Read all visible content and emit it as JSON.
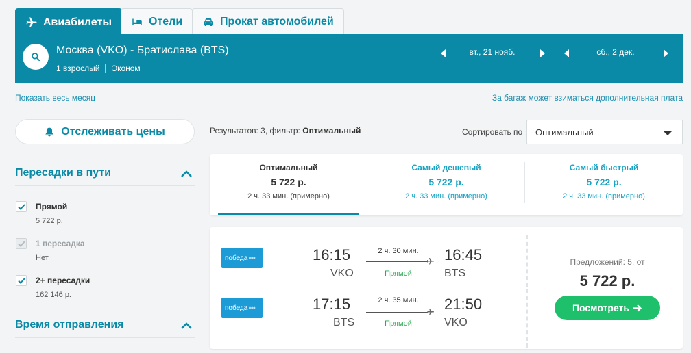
{
  "tabs": [
    {
      "label": "Авиабилеты",
      "icon": "plane-icon"
    },
    {
      "label": "Отели",
      "icon": "bed-icon"
    },
    {
      "label": "Прокат автомобилей",
      "icon": "car-icon"
    }
  ],
  "search": {
    "route": "Москва (VKO) - Братислава (BTS)",
    "passengers": "1 взрослый",
    "class": "Эконом",
    "depart_date": "вт., 21 нояб.",
    "return_date": "сб., 2 дек."
  },
  "links": {
    "show_month": "Показать весь месяц",
    "baggage_note": "За багаж может взиматься дополнительная плата"
  },
  "sidebar": {
    "track_prices": "Отслеживать цены",
    "stops_title": "Пересадки в пути",
    "stops": [
      {
        "label": "Прямой",
        "sub": "5 722 р.",
        "checked": true,
        "disabled": false
      },
      {
        "label": "1 пересадка",
        "sub": "Нет",
        "checked": true,
        "disabled": true
      },
      {
        "label": "2+ пересадки",
        "sub": "162 146 р.",
        "checked": true,
        "disabled": false
      }
    ],
    "departure_title": "Время отправления"
  },
  "results": {
    "count_text": "Результатов: 3, фильтр:",
    "filter": "Оптимальный",
    "sort_label": "Сортировать по",
    "sort_value": "Оптимальный"
  },
  "sort_tabs": [
    {
      "title": "Оптимальный",
      "price": "5 722 р.",
      "duration": "2 ч. 33 мин. (примерно)",
      "active": true
    },
    {
      "title": "Самый дешевый",
      "price": "5 722 р.",
      "duration": "2 ч. 33 мин. (примерно)",
      "active": false
    },
    {
      "title": "Самый быстрый",
      "price": "5 722 р.",
      "duration": "2 ч. 33 мин. (примерно)",
      "active": false
    }
  ],
  "result": {
    "airline": "победа",
    "legs": [
      {
        "dep_time": "16:15",
        "dep_code": "VKO",
        "duration": "2 ч. 30 мин.",
        "stops": "Прямой",
        "arr_time": "16:45",
        "arr_code": "BTS"
      },
      {
        "dep_time": "17:15",
        "dep_code": "BTS",
        "duration": "2 ч. 35 мин.",
        "stops": "Прямой",
        "arr_time": "21:50",
        "arr_code": "VKO"
      }
    ],
    "offers": "Предложений: 5, от",
    "price": "5 722 р.",
    "view_button": "Посмотреть"
  },
  "colors": {
    "brand": "#0a8aa6",
    "accent_green": "#1ec06b",
    "link": "#1a8fb0"
  }
}
